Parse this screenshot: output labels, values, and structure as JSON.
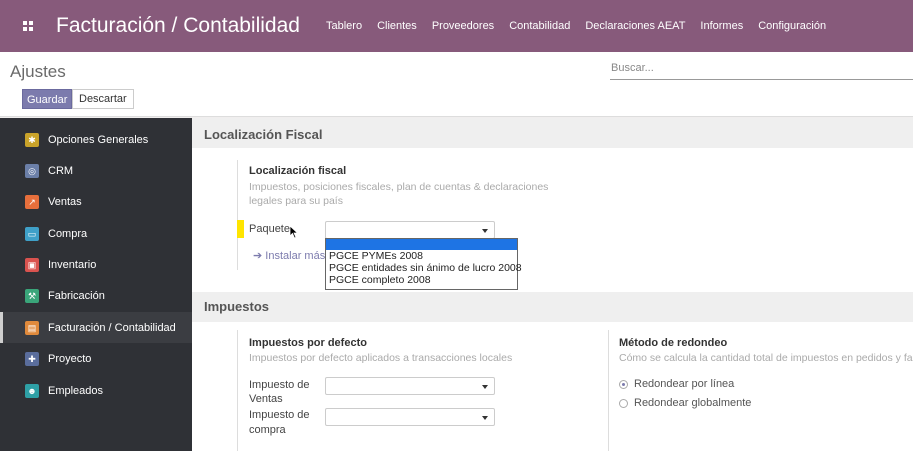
{
  "navbar": {
    "app_title": "Facturación / Contabilidad",
    "menu": [
      "Tablero",
      "Clientes",
      "Proveedores",
      "Contabilidad",
      "Declaraciones AEAT",
      "Informes",
      "Configuración"
    ]
  },
  "control_panel": {
    "breadcrumb": "Ajustes",
    "save_label": "Guardar",
    "discard_label": "Descartar",
    "search_placeholder": "Buscar..."
  },
  "sidebar": {
    "items": [
      {
        "label": "Opciones Generales",
        "icon": "gear-icon",
        "color": "#c9a32a"
      },
      {
        "label": "CRM",
        "icon": "handshake-icon",
        "color": "#6b7fa8"
      },
      {
        "label": "Ventas",
        "icon": "chart-icon",
        "color": "#e76f3c"
      },
      {
        "label": "Compra",
        "icon": "card-icon",
        "color": "#3fa0c8"
      },
      {
        "label": "Inventario",
        "icon": "box-icon",
        "color": "#d9534f"
      },
      {
        "label": "Fabricación",
        "icon": "wrench-icon",
        "color": "#3aa57a"
      },
      {
        "label": "Facturación / Contabilidad",
        "icon": "invoice-icon",
        "color": "#e08a3c"
      },
      {
        "label": "Proyecto",
        "icon": "puzzle-icon",
        "color": "#5a6d9c"
      },
      {
        "label": "Empleados",
        "icon": "people-icon",
        "color": "#2ea0a6"
      }
    ],
    "active_index": 6
  },
  "fiscal": {
    "section_title": "Localización Fiscal",
    "setting_title": "Localización fiscal",
    "help_line1": "Impuestos, posiciones fiscales, plan de cuentas & declaraciones",
    "help_line2": "legales para su país",
    "package_label": "Paquete",
    "install_more": "Instalar más p",
    "dropdown_options": [
      "PGCE PYMEs 2008",
      "PGCE entidades sin ánimo de lucro 2008",
      "PGCE completo 2008"
    ]
  },
  "taxes": {
    "section_title": "Impuestos",
    "default_title": "Impuestos por defecto",
    "default_help": "Impuestos por defecto aplicados a transacciones locales",
    "sales_tax_label_1": "Impuesto de",
    "sales_tax_label_2": "Ventas",
    "purchase_tax_label_1": "Impuesto de",
    "purchase_tax_label_2": "compra",
    "rounding_title": "Método de redondeo",
    "rounding_help": "Cómo se calcula la cantidad total de impuestos en pedidos y factu",
    "round_per_line": "Redondear por línea",
    "round_globally": "Redondear globalmente"
  }
}
